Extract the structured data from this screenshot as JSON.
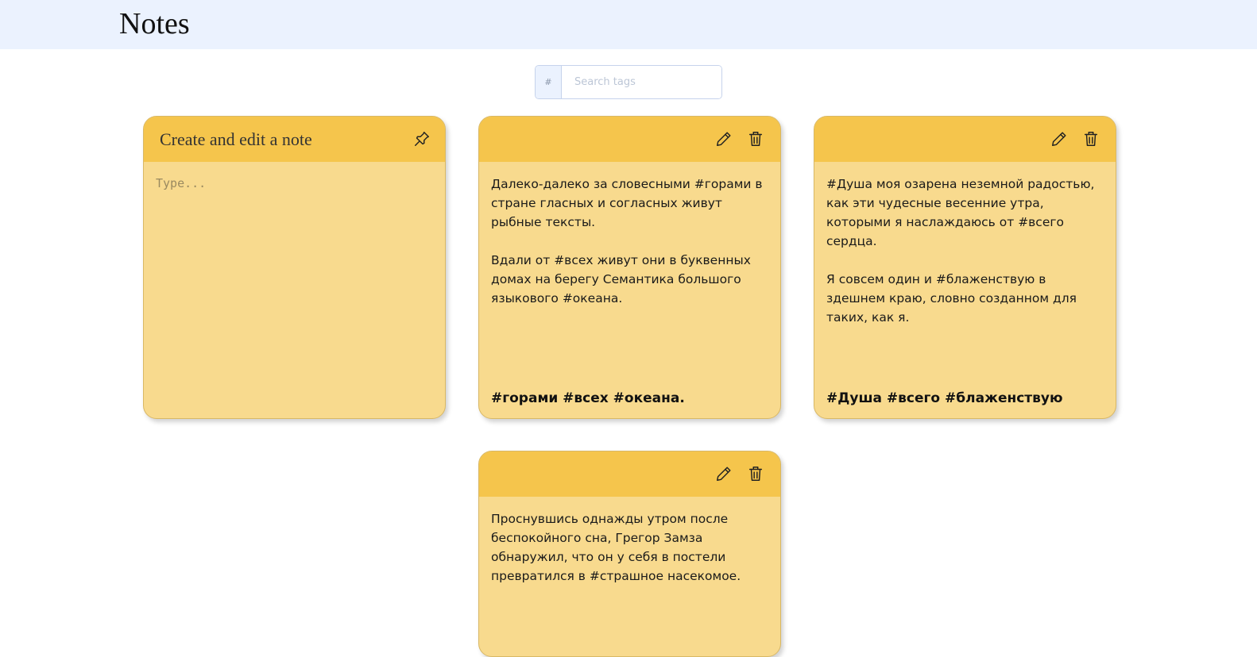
{
  "app": {
    "title": "Notes"
  },
  "search": {
    "prefix": "#",
    "placeholder": "Search tags",
    "value": ""
  },
  "create_card": {
    "title": "Create and edit a note",
    "placeholder": "Type...",
    "pin_icon": "pin-icon"
  },
  "notes": [
    {
      "paragraphs": [
        "Далеко-далеко за словесными #горами в стране гласных и согласных живут рыбные тексты.",
        "Вдали от #всех живут они в буквенных домах на берегу Семантика большого языкового #океана."
      ],
      "tags": "#горами #всех #океана."
    },
    {
      "paragraphs": [
        "#Душа моя озарена неземной радостью, как эти чудесные весенние утра, которыми я наслаждаюсь от #всего сердца.",
        "Я совсем один и #блаженствую в здешнем краю, словно созданном для таких, как я."
      ],
      "tags": "#Душа #всего #блаженствую"
    },
    {
      "paragraphs": [
        "Проснувшись однажды утром после беспокойного сна, Грегор Замза обнаружил, что он у себя в постели превратился в #страшное насекомое."
      ],
      "tags": ""
    }
  ],
  "icons": {
    "edit": "pencil-icon",
    "delete": "trash-icon"
  },
  "colors": {
    "header_bg": "#ebf2fe",
    "card_head": "#f5c54c",
    "card_body": "#f8da8e"
  }
}
